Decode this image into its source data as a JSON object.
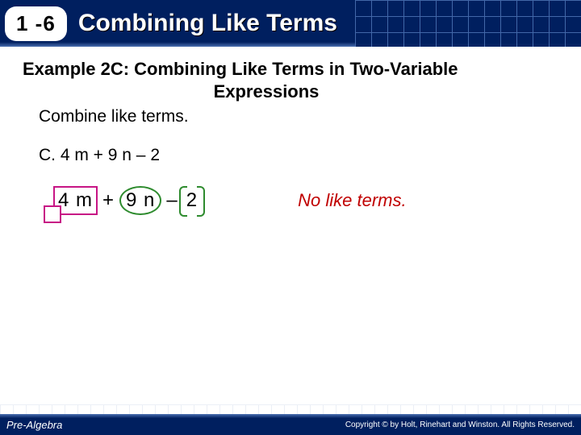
{
  "header": {
    "lesson_number": "1 -6",
    "lesson_title": "Combining Like Terms"
  },
  "example": {
    "title_line1": "Example 2C: Combining Like Terms in Two-Variable",
    "title_line2": "Expressions",
    "instruction": "Combine like terms.",
    "problem_label": "C.  4 m + 9 n – 2"
  },
  "expression": {
    "term1": "4 m",
    "op1": "+",
    "term2": "9 n",
    "op2": "–",
    "term3": "2"
  },
  "explanation": "No like terms.",
  "footer": {
    "course": "Pre-Algebra",
    "copyright": "Copyright © by Holt, Rinehart and Winston. All Rights Reserved."
  }
}
